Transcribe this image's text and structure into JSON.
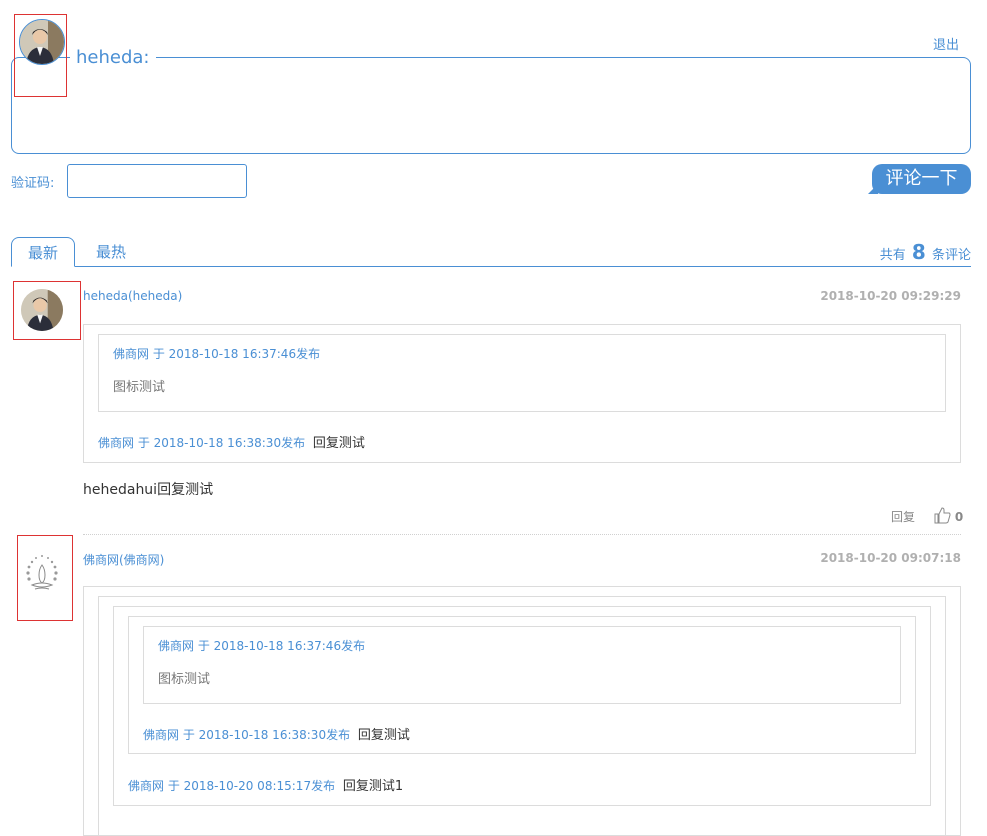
{
  "header": {
    "username": "heheda:",
    "logout": "退出",
    "captcha_label": "验证码:",
    "captcha_value": "",
    "submit": "评论一下"
  },
  "tabs": {
    "latest": "最新",
    "hot": "最热",
    "count_prefix": "共有",
    "count": "8",
    "count_suffix": "条评论"
  },
  "comments": [
    {
      "author": "heheda(heheda)",
      "time": "2018-10-20 09:29:29",
      "quote_inner_meta": "佛商网 于 2018-10-18 16:37:46发布",
      "quote_inner_body": "图标测试",
      "quote_outer_meta": "佛商网 于 2018-10-18 16:38:30发布",
      "quote_outer_body": "回复测试",
      "body": "hehedahui回复测试",
      "reply": "回复",
      "likes": "0"
    },
    {
      "author": "佛商网(佛商网)",
      "time": "2018-10-20 09:07:18",
      "quote_l3_meta": "佛商网 于 2018-10-18 16:37:46发布",
      "quote_l3_body": "图标测试",
      "quote_l2_meta": "佛商网 于 2018-10-18 16:38:30发布",
      "quote_l2_body": "回复测试",
      "quote_l1_meta": "佛商网 于 2018-10-20 08:15:17发布",
      "quote_l1_body": "回复测试1"
    }
  ],
  "colors": {
    "accent": "#4a8fd4",
    "border": "#dcdcdc",
    "red_outline": "#dd3333"
  }
}
